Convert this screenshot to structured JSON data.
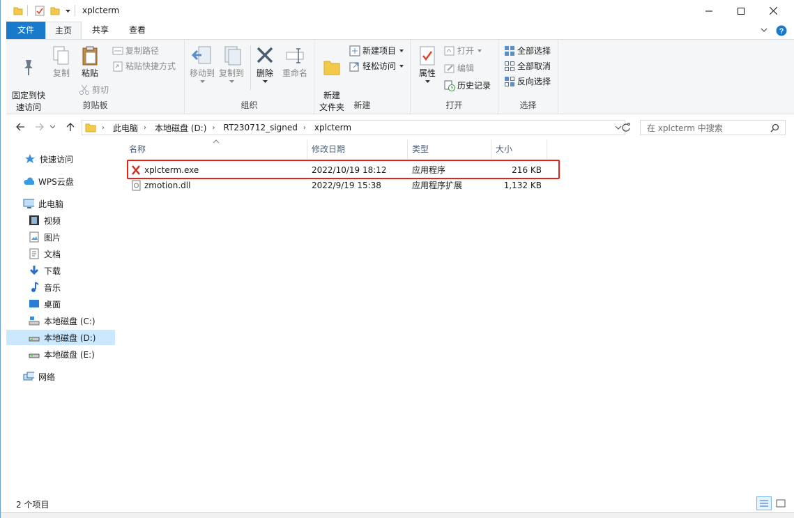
{
  "window": {
    "title": "xplcterm"
  },
  "ribbon_tabs": {
    "file": "文件",
    "home": "主页",
    "share": "共享",
    "view": "查看"
  },
  "clipboard": {
    "label": "剪贴板",
    "pin": "固定到快\n速访问",
    "copy": "复制",
    "paste": "粘贴",
    "copy_path": "复制路径",
    "paste_shortcut": "粘贴快捷方式",
    "cut": "剪切"
  },
  "organize": {
    "label": "组织",
    "move_to": "移动到",
    "copy_to": "复制到",
    "delete": "删除",
    "rename": "重命名"
  },
  "new": {
    "label": "新建",
    "new_folder": "新建\n文件夹",
    "new_item": "新建项目",
    "easy_access": "轻松访问"
  },
  "open": {
    "label": "打开",
    "properties": "属性",
    "open": "打开",
    "edit": "编辑",
    "history": "历史记录"
  },
  "select": {
    "label": "选择",
    "select_all": "全部选择",
    "select_none": "全部取消",
    "invert": "反向选择"
  },
  "address": {
    "crumbs": [
      "此电脑",
      "本地磁盘 (D:)",
      "RT230712_signed",
      "xplcterm"
    ],
    "search_placeholder": "在 xplcterm 中搜索"
  },
  "nav": {
    "quick_access": "快速访问",
    "wps": "WPS云盘",
    "this_pc": "此电脑",
    "videos": "视频",
    "pictures": "图片",
    "documents": "文档",
    "downloads": "下载",
    "music": "音乐",
    "desktop": "桌面",
    "drive_c": "本地磁盘 (C:)",
    "drive_d": "本地磁盘 (D:)",
    "drive_e": "本地磁盘 (E:)",
    "network": "网络"
  },
  "columns": {
    "name": "名称",
    "date": "修改日期",
    "type": "类型",
    "size": "大小"
  },
  "files": [
    {
      "name": "xplcterm.exe",
      "date": "2022/10/19 18:12",
      "type": "应用程序",
      "size": "216 KB"
    },
    {
      "name": "zmotion.dll",
      "date": "2022/9/19 15:38",
      "type": "应用程序扩展",
      "size": "1,132 KB"
    }
  ],
  "status": {
    "count": "2 个项目"
  },
  "colors": {
    "accent": "#1979ca",
    "highlight_border": "#e8201a",
    "selected_bg": "#cce8ff"
  }
}
